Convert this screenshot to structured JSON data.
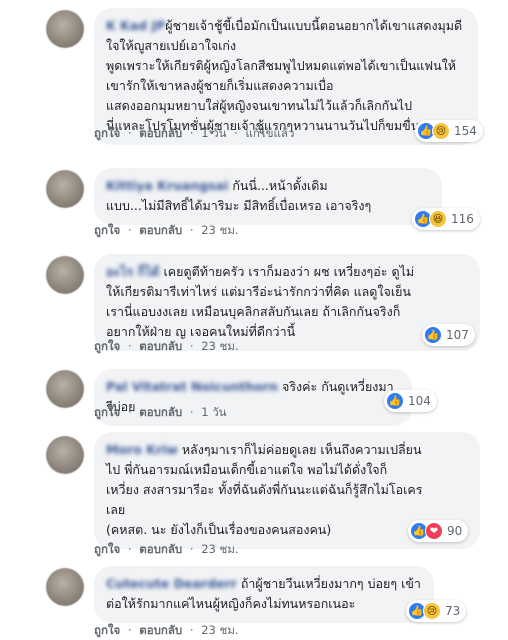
{
  "comments": [
    {
      "author": "K Kad JP",
      "text": "ผู้ชายเจ้าชู้ขี้เบื่อมักเป็นแบบนี้ตอนอยากได้เขาแสดงมุมดีใจให้ญูสายเปย์เอาใจเก่ง\nพูดเพราะให้เกียรติผู้หญิงโลกสีชมพูไปหมดแต่พอได้เขาเป็นแฟนให้เขารักให้เขาหลงผู้ชายก็เริ่มแสดงความเบื่อ\nแสดงออกมุมหยาบใส่ผู้หญิงจนเขาทนไม่ไว้แล้วก็เลิกกันไป\nนี่แหละโปรโมทชั่นผู้ชายเจ้าชู้แรกๆหวานนานวันไปก็ขมขื่น",
      "like": "ถูกใจ",
      "reply": "ตอบกลับ",
      "time": "1 วัน",
      "edited": "แก้ไขแล้ว",
      "reactions": [
        "like",
        "sad"
      ],
      "count": "154"
    },
    {
      "author": "Kittiya Kruangsai",
      "text": "กันนี่...หน้าดั้งเดิม\nแบบ...ไม่มีสิทธิ์ได้มาริมะ มีสิทธิ์เบื่อเหรอ เอาจริงๆ",
      "like": "ถูกใจ",
      "reply": "ตอบกลับ",
      "time": "23 ชม.",
      "edited": "",
      "reactions": [
        "like",
        "haha"
      ],
      "count": "116"
    },
    {
      "author": "อะไร ก็ได้",
      "text": "เคยดูตีท้ายครัว เราก็มองว่า ผช เหวี่ยงๆอ่ะ ดูไม่\nให้เกียรติมารีเท่าไหร่ แต่มารีอ่ะน่ารักกว่าที่คิด แลดูใจเย็น\nเรานี่แอบงงเลย เหมือนบุคลิกสลับกันเลย ถ้าเลิกกันจริงก็\nอยากให้ฝ่าย ญ เจอคนใหม่ที่ดีกว่านี้",
      "like": "ถูกใจ",
      "reply": "ตอบกลับ",
      "time": "23 ชม.",
      "edited": "",
      "reactions": [
        "like"
      ],
      "count": "107"
    },
    {
      "author": "Pal Vitatrat Noicunthorn",
      "text": "จริงค่ะ กันดูเหวี่ยงมารีบ่อย",
      "like": "ถูกใจ",
      "reply": "ตอบกลับ",
      "time": "1 วัน",
      "edited": "",
      "reactions": [
        "like"
      ],
      "count": "104"
    },
    {
      "author": "Moro Kriw",
      "text": "หลังๆมาเราก็ไม่ค่อยดูเลย เห็นถึงความเปลี่ยน\nไป พี่กันอารมณ์เหมือนเด็กขี้เอาแต่ใจ พอไม่ได้ดั่งใจก็\nเหวี่ยง สงสารมารีอะ ทั้งที่ฉันดังพี่กันนะแต่ฉันก็รู้สึกไม่โอเคร\nเลย\n(คหสต. นะ ยังไงก็เป็นเรื่องของคนสองคน)",
      "like": "ถูกใจ",
      "reply": "ตอบกลับ",
      "time": "23 ชม.",
      "edited": "",
      "reactions": [
        "like",
        "love"
      ],
      "count": "90"
    },
    {
      "author": "Cutecute Dearderr",
      "text": "ถ้าผู้ชายวีนเหวี่ยงมากๆ บ่อยๆ เข้า\nต่อให้รักมากแค่ไหนผู้หญิงก็คงไม่ทนหรอกเนอะ",
      "like": "ถูกใจ",
      "reply": "ตอบกลับ",
      "time": "23 ชม.",
      "edited": "",
      "reactions": [
        "like",
        "sad"
      ],
      "count": "73"
    }
  ],
  "separator": "·",
  "colors": {
    "like": "#2e7bf6",
    "love": "#f33e58",
    "sad": "#f5c33b",
    "link": "#385898"
  }
}
